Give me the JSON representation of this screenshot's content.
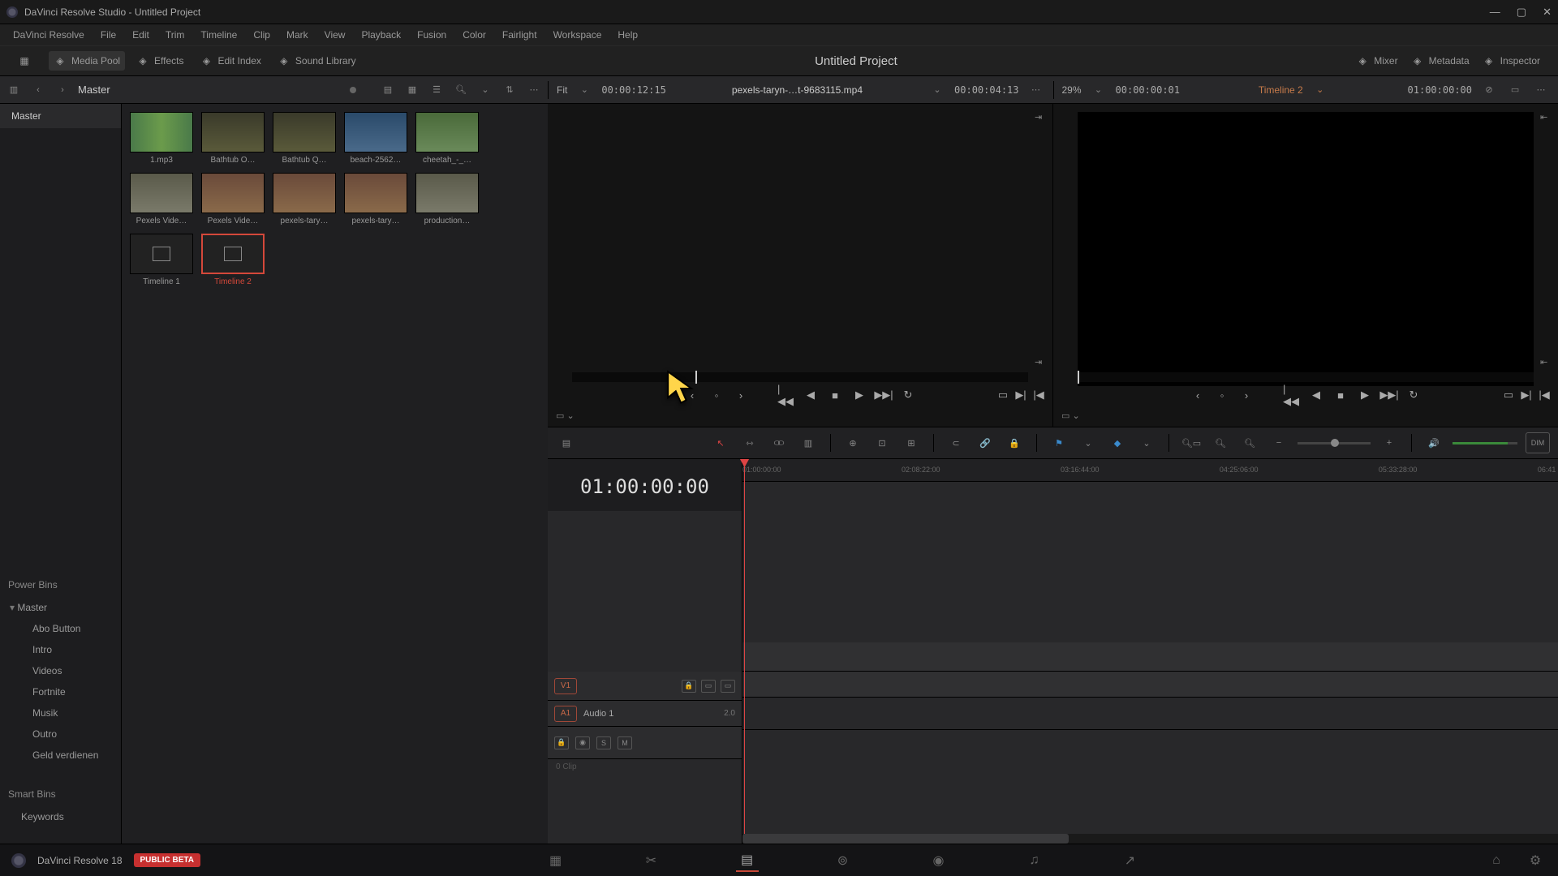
{
  "window": {
    "title": "DaVinci Resolve Studio - Untitled Project"
  },
  "menubar": [
    "DaVinci Resolve",
    "File",
    "Edit",
    "Trim",
    "Timeline",
    "Clip",
    "Mark",
    "View",
    "Playback",
    "Fusion",
    "Color",
    "Fairlight",
    "Workspace",
    "Help"
  ],
  "toolbar": {
    "left": [
      {
        "icon": "media-pool-icon",
        "label": "Media Pool",
        "active": true
      },
      {
        "icon": "effects-icon",
        "label": "Effects"
      },
      {
        "icon": "edit-index-icon",
        "label": "Edit Index"
      },
      {
        "icon": "sound-library-icon",
        "label": "Sound Library"
      }
    ],
    "project_title": "Untitled Project",
    "right": [
      {
        "icon": "mixer-icon",
        "label": "Mixer"
      },
      {
        "icon": "metadata-icon",
        "label": "Metadata"
      },
      {
        "icon": "inspector-icon",
        "label": "Inspector"
      }
    ]
  },
  "secbar": {
    "breadcrumb": "Master",
    "source": {
      "fit": "Fit",
      "duration": "00:00:12:15",
      "clipname": "pexels-taryn-…t-9683115.mp4",
      "timecode": "00:00:04:13"
    },
    "program": {
      "zoom": "29%",
      "duration": "00:00:00:01",
      "timeline_name": "Timeline 2",
      "timecode": "01:00:00:00"
    }
  },
  "sidebar": {
    "masterbin": "Master",
    "powerbins_label": "Power Bins",
    "powerbins_master": "Master",
    "powerbins": [
      "Abo Button",
      "Intro",
      "Videos",
      "Fortnite",
      "Musik",
      "Outro",
      "Geld verdienen"
    ],
    "smartbins_label": "Smart Bins",
    "smartbins": [
      "Keywords"
    ]
  },
  "clips": [
    {
      "label": "1.mp3",
      "type": "audio"
    },
    {
      "label": "Bathtub O…",
      "type": "video1"
    },
    {
      "label": "Bathtub Q…",
      "type": "video1"
    },
    {
      "label": "beach-2562…",
      "type": "video2"
    },
    {
      "label": "cheetah_-_…",
      "type": "video3"
    },
    {
      "label": "Pexels Vide…",
      "type": "video5"
    },
    {
      "label": "Pexels Vide…",
      "type": "video4"
    },
    {
      "label": "pexels-tary…",
      "type": "video4"
    },
    {
      "label": "pexels-tary…",
      "type": "video4"
    },
    {
      "label": "production…",
      "type": "video5"
    },
    {
      "label": "Timeline 1",
      "type": "tl"
    },
    {
      "label": "Timeline 2",
      "type": "tl",
      "selected": true
    }
  ],
  "timeline": {
    "timecode": "01:00:00:00",
    "ruler": [
      "01:00:00:00",
      "02:08:22:00",
      "03:16:44:00",
      "04:25:06:00",
      "05:33:28:00",
      "06:41"
    ],
    "video_track": "V1",
    "audio_track": "A1",
    "audio_name": "Audio 1",
    "audio_ch": "2.0",
    "clip_count": "0 Clip",
    "solo": "S",
    "mute": "M"
  },
  "bottomnav": {
    "app": "DaVinci Resolve 18",
    "badge": "PUBLIC BETA"
  }
}
